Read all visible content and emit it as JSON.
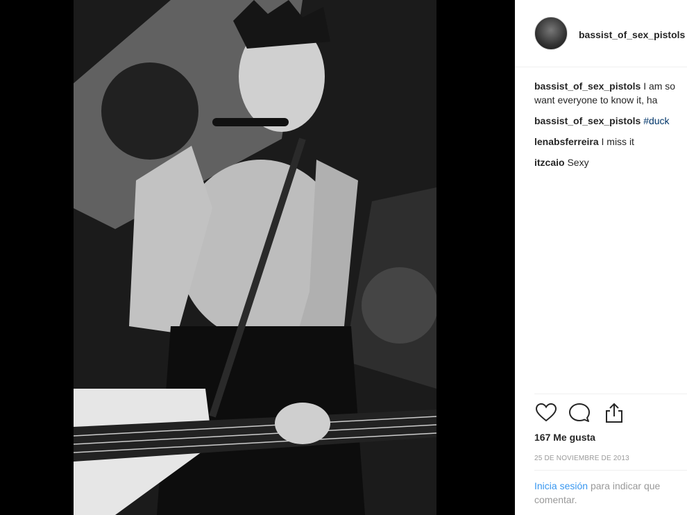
{
  "post": {
    "header_username": "bassist_of_sex_pistols",
    "comments": [
      {
        "user": "bassist_of_sex_pistols",
        "text_line1": "I am so",
        "text_line2": "want everyone to know it, ha",
        "hashtag": ""
      },
      {
        "user": "bassist_of_sex_pistols",
        "text_line1": "",
        "text_line2": "",
        "hashtag": "#duck"
      },
      {
        "user": "lenabsferreira",
        "text_line1": "I miss it",
        "text_line2": "",
        "hashtag": ""
      },
      {
        "user": "itzcaio",
        "text_line1": "Sexy",
        "text_line2": "",
        "hashtag": ""
      }
    ],
    "likes": "167 Me gusta",
    "date": "25 DE NOVIEMBRE DE 2013",
    "login_link": "Inicia sesión",
    "login_text": "para indicar que",
    "login_text2": "comentar."
  },
  "icons": {
    "like": "heart-icon",
    "comment": "comment-icon",
    "share": "share-icon"
  },
  "colors": {
    "link": "#3897f0",
    "hashtag": "#003569",
    "text": "#262626",
    "muted": "#999999"
  }
}
